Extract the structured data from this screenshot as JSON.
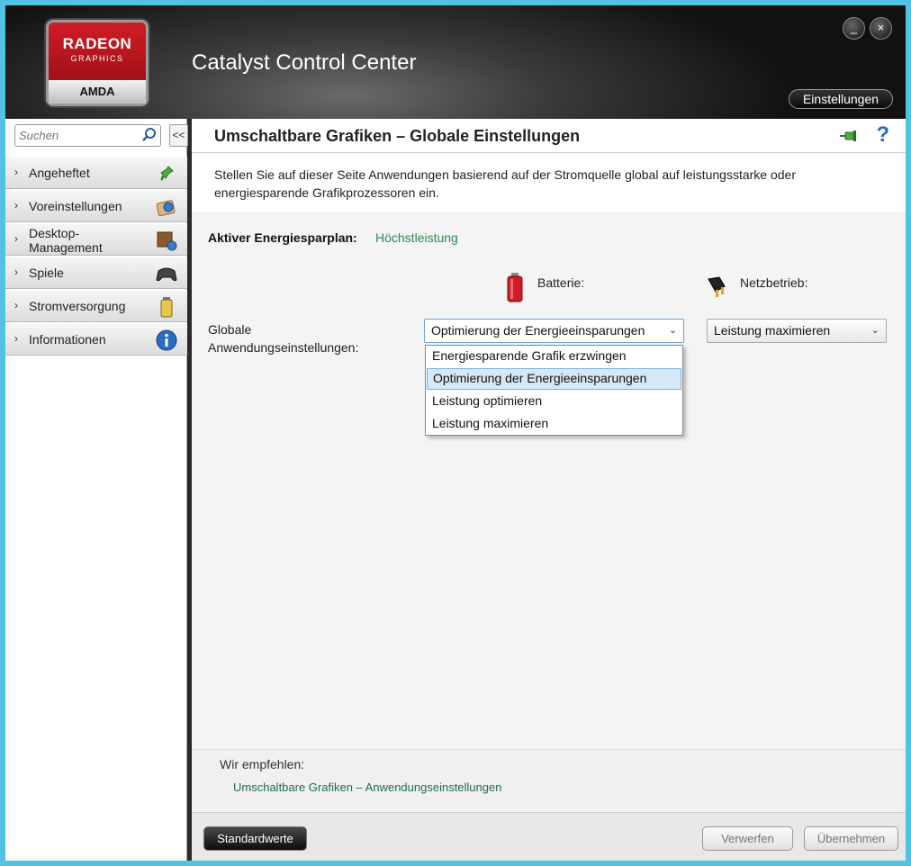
{
  "header": {
    "logo": {
      "line1": "RADEON",
      "line2": "GRAPHICS",
      "line3": "AMDA"
    },
    "title": "Catalyst Control Center",
    "settings_label": "Einstellungen",
    "minimize_label": "_",
    "close_label": "×"
  },
  "sidebar": {
    "search_placeholder": "Suchen",
    "collapse_label": "<<",
    "items": [
      {
        "label": "Angeheftet",
        "icon": "pin-icon"
      },
      {
        "label": "Voreinstellungen",
        "icon": "presets-icon"
      },
      {
        "label": "Desktop-Management",
        "line1": "Desktop-",
        "line2": "Management",
        "icon": "desktop-management-icon"
      },
      {
        "label": "Spiele",
        "icon": "gamepad-icon"
      },
      {
        "label": "Stromversorgung",
        "icon": "battery-power-icon"
      },
      {
        "label": "Informationen",
        "icon": "info-icon"
      }
    ]
  },
  "main": {
    "title": "Umschaltbare Grafiken – Globale Einstellungen",
    "description": "Stellen Sie auf dieser Seite Anwendungen basierend auf der Stromquelle global auf leistungsstarke oder energiesparende Grafikprozessoren ein.",
    "plan_label": "Aktiver Energiesparplan:",
    "plan_value": "Höchstleistung",
    "battery_label": "Batterie:",
    "ac_label": "Netzbetrieb:",
    "row_label_line1": "Globale",
    "row_label_line2": "Anwendungseinstellungen:",
    "battery_select_value": "Optimierung der Energieeinsparungen",
    "ac_select_value": "Leistung maximieren",
    "dropdown_options": [
      "Energiesparende Grafik erzwingen",
      "Optimierung der Energieeinsparungen",
      "Leistung optimieren",
      "Leistung maximieren"
    ],
    "dropdown_selected_index": 1,
    "recommend_label": "Wir empfehlen:",
    "recommend_link": "Umschaltbare Grafiken – Anwendungseinstellungen"
  },
  "footer": {
    "defaults_label": "Standardwerte",
    "discard_label": "Verwerfen",
    "apply_label": "Übernehmen"
  },
  "colors": {
    "accent_frame": "#4fc3e0",
    "amd_red": "#d01c25",
    "link_green": "#2a8a55",
    "help_blue": "#2a6cc0"
  }
}
